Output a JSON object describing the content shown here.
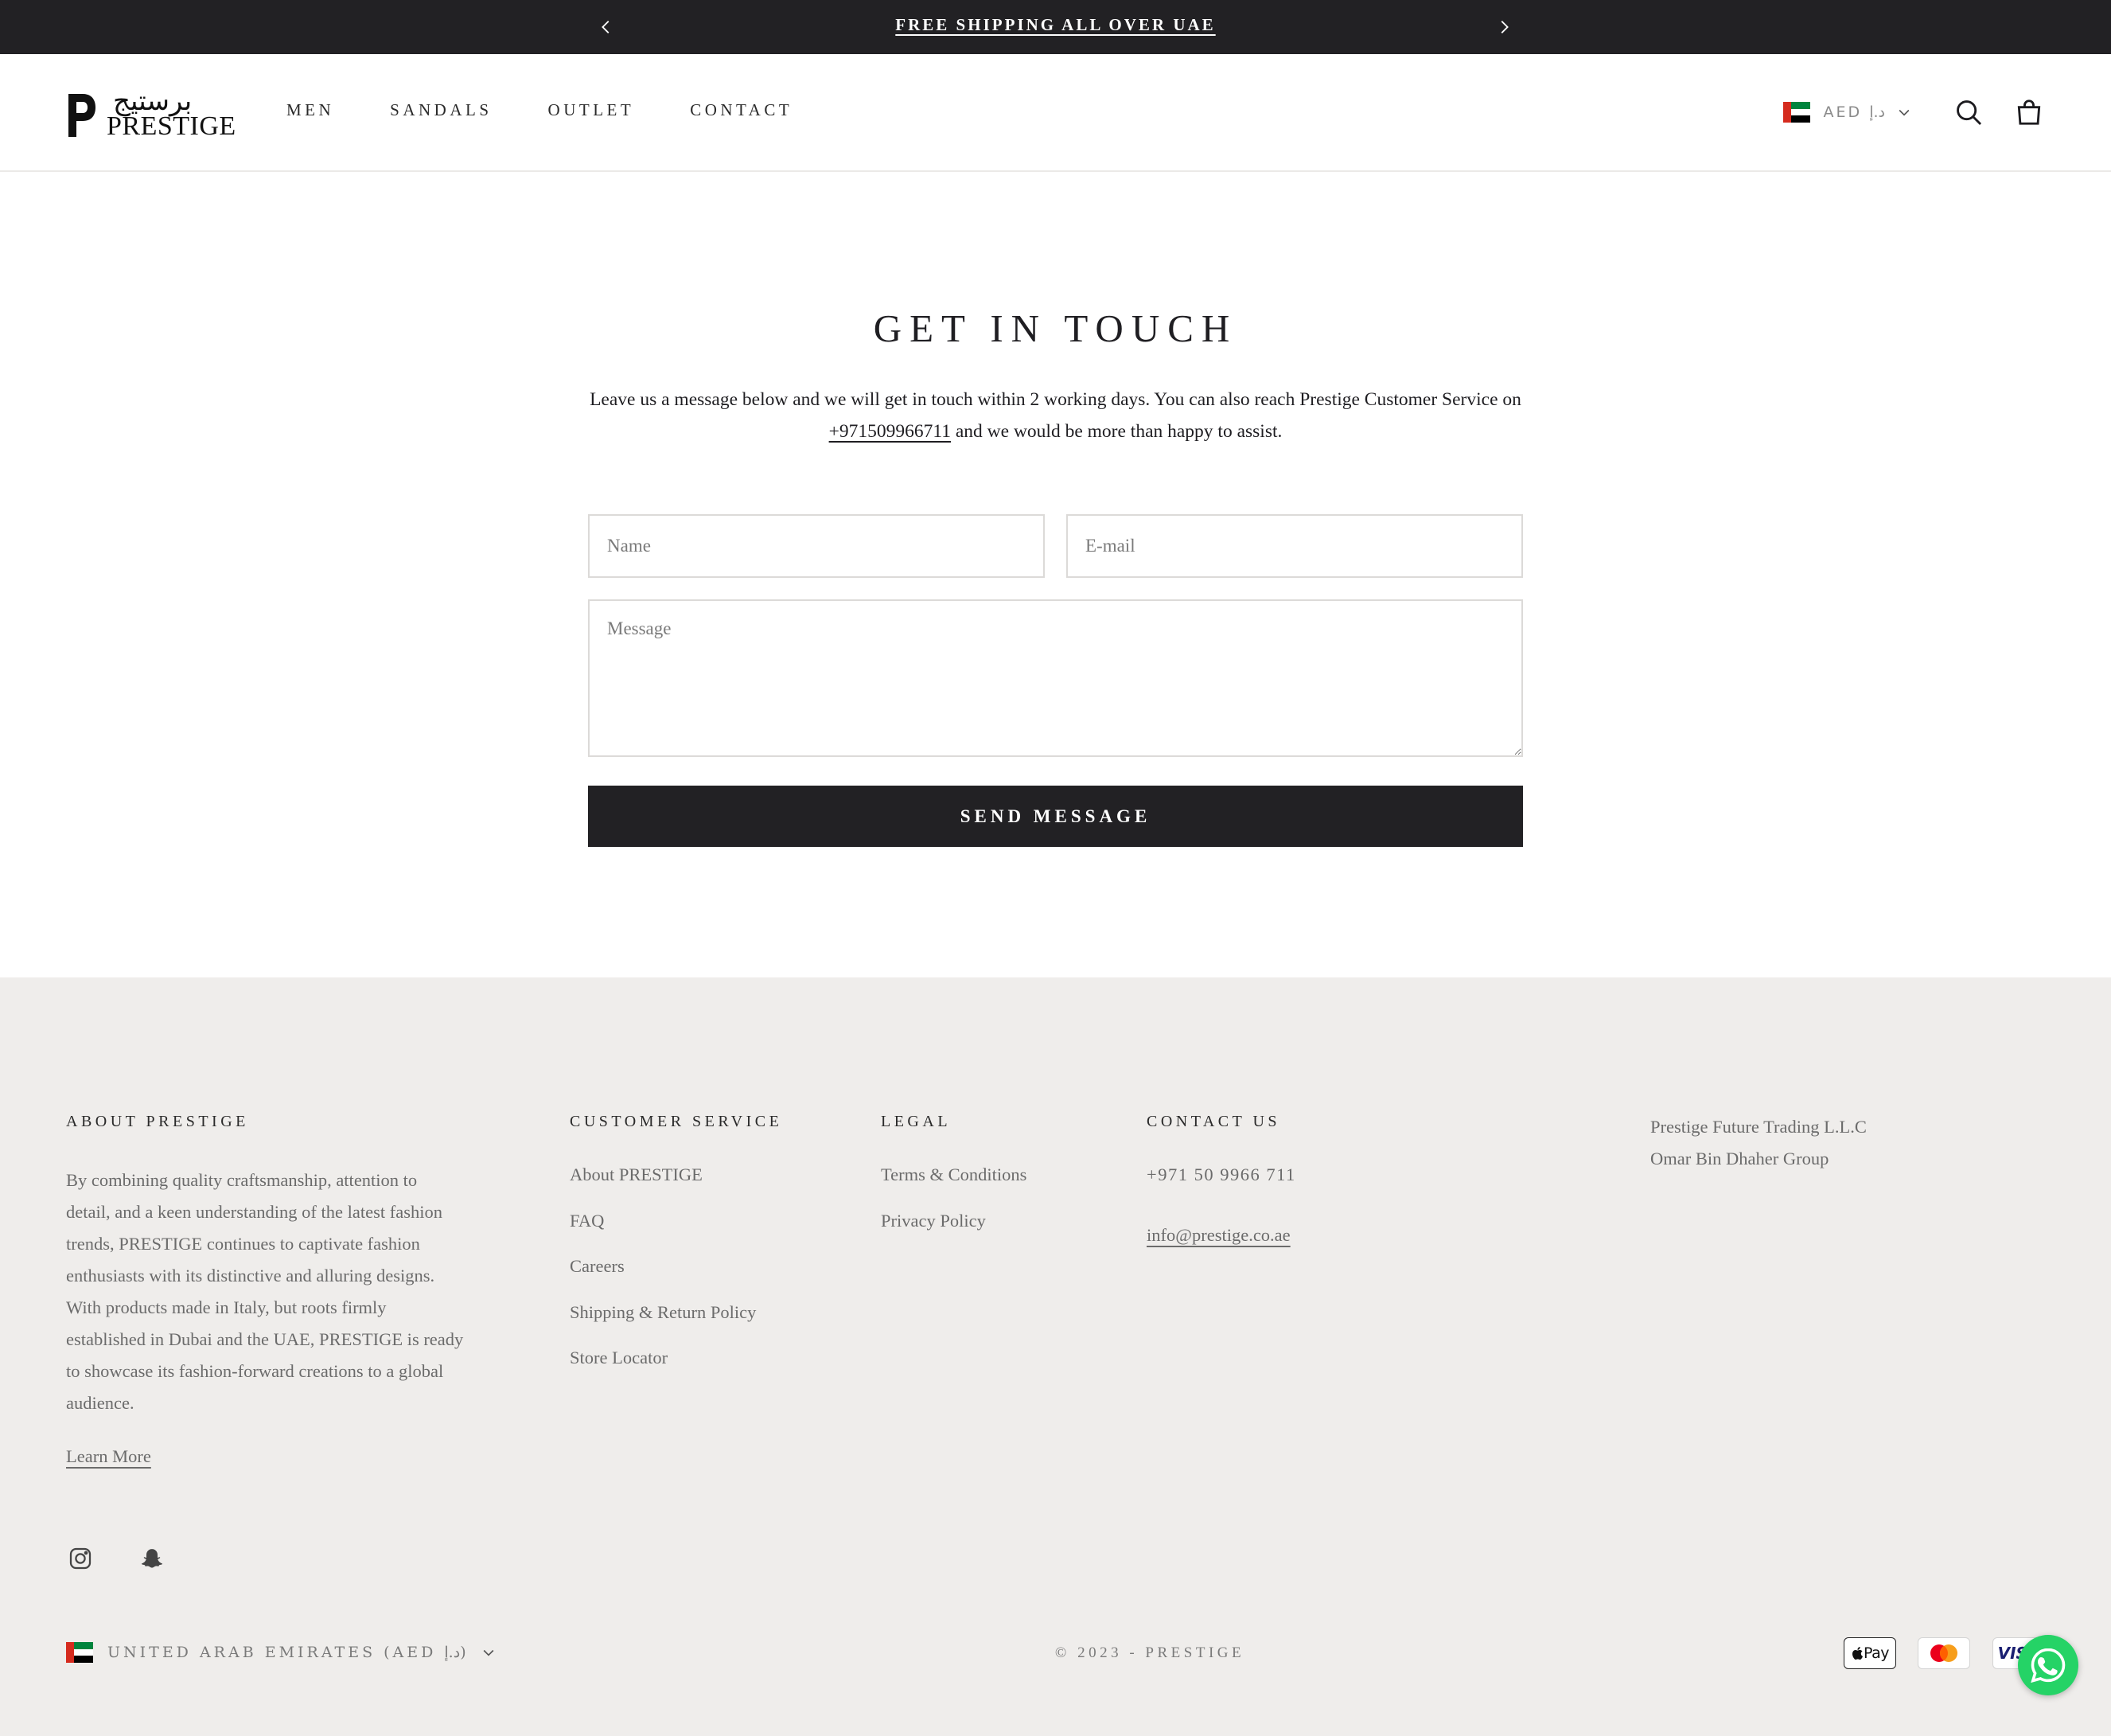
{
  "announcement": {
    "message": "FREE SHIPPING ALL OVER UAE",
    "prev_icon": "chevron-left-icon",
    "next_icon": "chevron-right-icon"
  },
  "header": {
    "logo_arabic": "برستيج",
    "logo_latin": "PRESTIGE",
    "nav": [
      "MEN",
      "SANDALS",
      "OUTLET",
      "CONTACT"
    ],
    "currency": "AED د.إ",
    "icons": [
      "uae-flag-icon",
      "chevron-down-icon",
      "search-icon",
      "shopping-bag-icon"
    ]
  },
  "contact_form": {
    "title": "GET IN TOUCH",
    "intro_before": "Leave us a message below and we will get in touch within 2 working days. You can also reach Prestige Customer Service on ",
    "intro_phone": "+971509966711",
    "intro_after": " and we would be more than happy to assist.",
    "name_placeholder": "Name",
    "email_placeholder": "E-mail",
    "message_placeholder": "Message",
    "submit_label": "SEND MESSAGE"
  },
  "footer": {
    "about": {
      "heading": "ABOUT PRESTIGE",
      "text": "By combining quality craftsmanship, attention to detail, and a keen understanding of the latest fashion trends, PRESTIGE continues to captivate fashion enthusiasts with its distinctive and alluring designs. With products made in Italy, but roots firmly established in Dubai and the UAE, PRESTIGE is ready to showcase its fashion-forward creations to a global audience.",
      "link": "Learn More"
    },
    "customer_service": {
      "heading": "CUSTOMER SERVICE",
      "links": [
        "About PRESTIGE",
        "FAQ",
        "Careers",
        "Shipping & Return Policy",
        "Store Locator"
      ]
    },
    "legal": {
      "heading": "LEGAL",
      "links": [
        "Terms & Conditions",
        "Privacy Policy"
      ]
    },
    "contact": {
      "heading": "CONTACT US",
      "phone": "+971 50 9966 711",
      "email": "info@prestige.co.ae"
    },
    "company": {
      "line1": "Prestige Future Trading L.L.C",
      "line2": "Omar Bin Dhaher Group"
    },
    "social_icons": [
      "instagram-icon",
      "snapchat-icon"
    ],
    "country_selector": "UNITED ARAB EMIRATES (AED د.إ)",
    "copyright": "© 2023 - PRESTIGE",
    "payment": {
      "apple_pay": "Pay",
      "visa": "VISA"
    },
    "whatsapp_icon": "whatsapp-icon"
  },
  "colors": {
    "dark": "#222124",
    "footer_bg": "#efedeb",
    "muted_text": "#6b6b6b",
    "whatsapp": "#25d366"
  }
}
